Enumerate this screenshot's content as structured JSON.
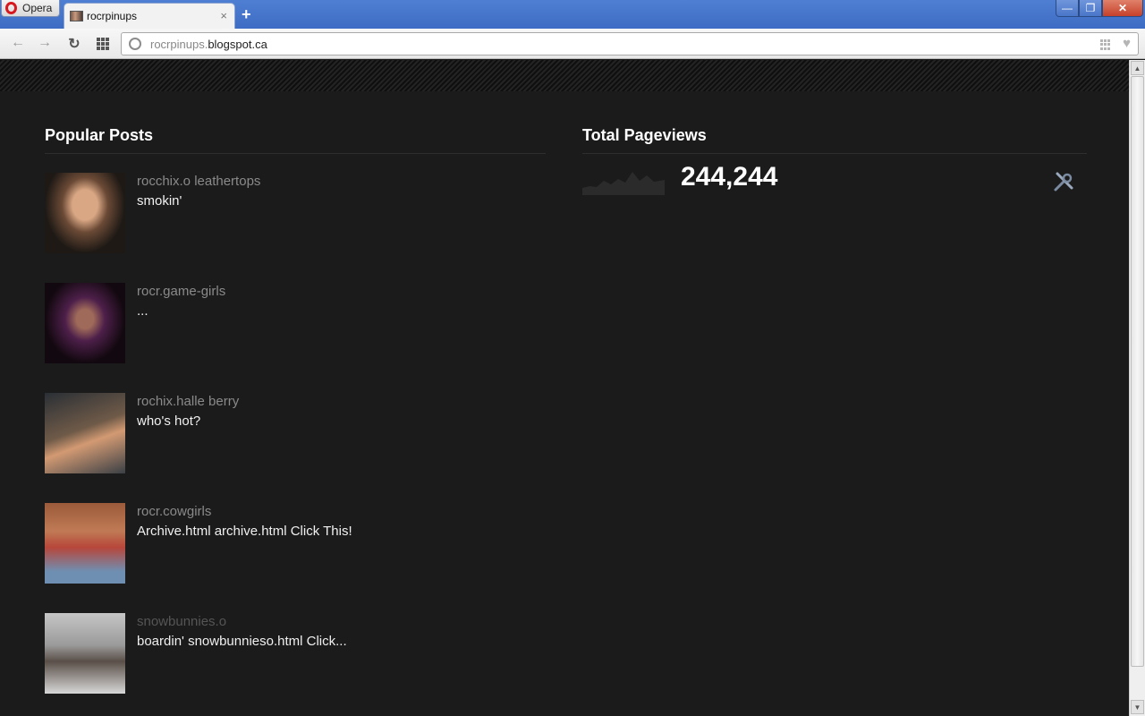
{
  "browser": {
    "menu_label": "Opera",
    "tab_title": "rocrpinups",
    "tab_close": "×",
    "new_tab": "+",
    "url_subdomain": "rocrpinups.",
    "url_domain": "blogspot.ca",
    "window_minimize": "—",
    "window_maximize": "❐",
    "window_close": "✕",
    "back": "←",
    "forward": "→",
    "reload": "↻"
  },
  "popular_posts": {
    "title": "Popular Posts",
    "items": [
      {
        "title": "rocchix.o leathertops",
        "snippet": "smokin'"
      },
      {
        "title": "rocr.game-girls",
        "snippet": "..."
      },
      {
        "title": "rochix.halle berry",
        "snippet": "who's hot?"
      },
      {
        "title": "rocr.cowgirls",
        "snippet": "Archive.html archive.html Click This!"
      },
      {
        "title": "snowbunnies.o",
        "snippet": "boardin' snowbunnieso.html Click..."
      }
    ]
  },
  "pageviews": {
    "title": "Total Pageviews",
    "count": "244,244"
  },
  "scrollbar": {
    "up": "▲",
    "down": "▼"
  }
}
